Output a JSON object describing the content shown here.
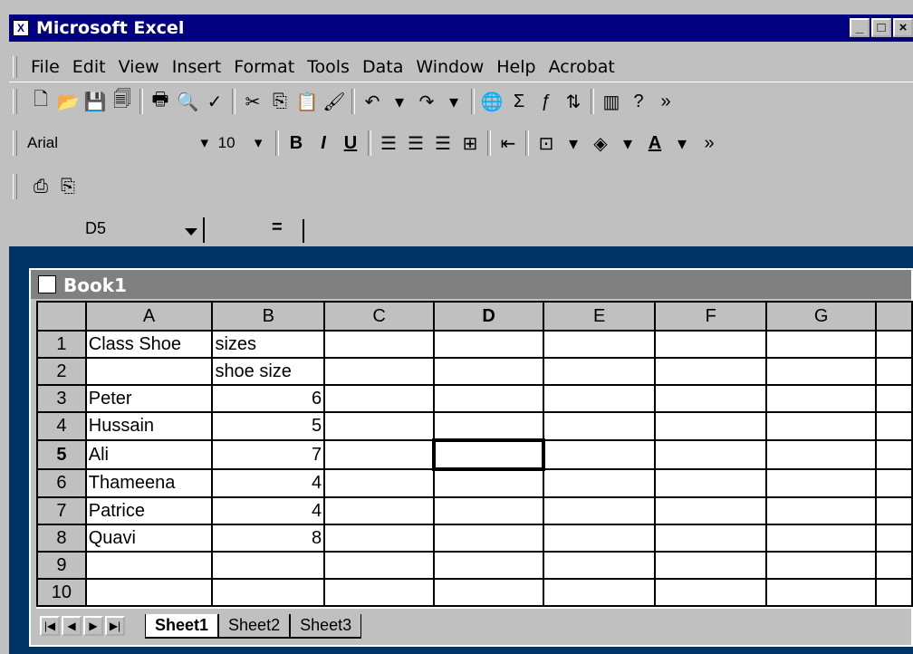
{
  "window": {
    "title": "Microsoft Excel",
    "controls": [
      "_",
      "□",
      "×"
    ]
  },
  "menu": [
    "File",
    "Edit",
    "View",
    "Insert",
    "Format",
    "Tools",
    "Data",
    "Window",
    "Help",
    "Acrobat"
  ],
  "format_toolbar": {
    "font": "Arial",
    "size": "10"
  },
  "formula_bar": {
    "cell_ref": "D5",
    "equals": "="
  },
  "workbook": {
    "title": "Book1"
  },
  "sheet": {
    "columns": [
      "A",
      "B",
      "C",
      "D",
      "E",
      "F",
      "G"
    ],
    "selected_cell": "D5",
    "rows": [
      {
        "n": "1",
        "a": "Class Shoe",
        "b": "sizes"
      },
      {
        "n": "2",
        "a": "",
        "b": "shoe size"
      },
      {
        "n": "3",
        "a": "Peter",
        "b": "6"
      },
      {
        "n": "4",
        "a": "Hussain",
        "b": "5"
      },
      {
        "n": "5",
        "a": "Ali",
        "b": "7"
      },
      {
        "n": "6",
        "a": "Thameena",
        "b": "4"
      },
      {
        "n": "7",
        "a": "Patrice",
        "b": "4"
      },
      {
        "n": "8",
        "a": "Quavi",
        "b": "8"
      },
      {
        "n": "9",
        "a": "",
        "b": ""
      },
      {
        "n": "10",
        "a": "",
        "b": ""
      }
    ]
  },
  "tabs": [
    "Sheet1",
    "Sheet2",
    "Sheet3"
  ],
  "colors": {
    "title_bar": "#000080",
    "desktop": "#003366",
    "chrome": "#c0c0c0"
  }
}
